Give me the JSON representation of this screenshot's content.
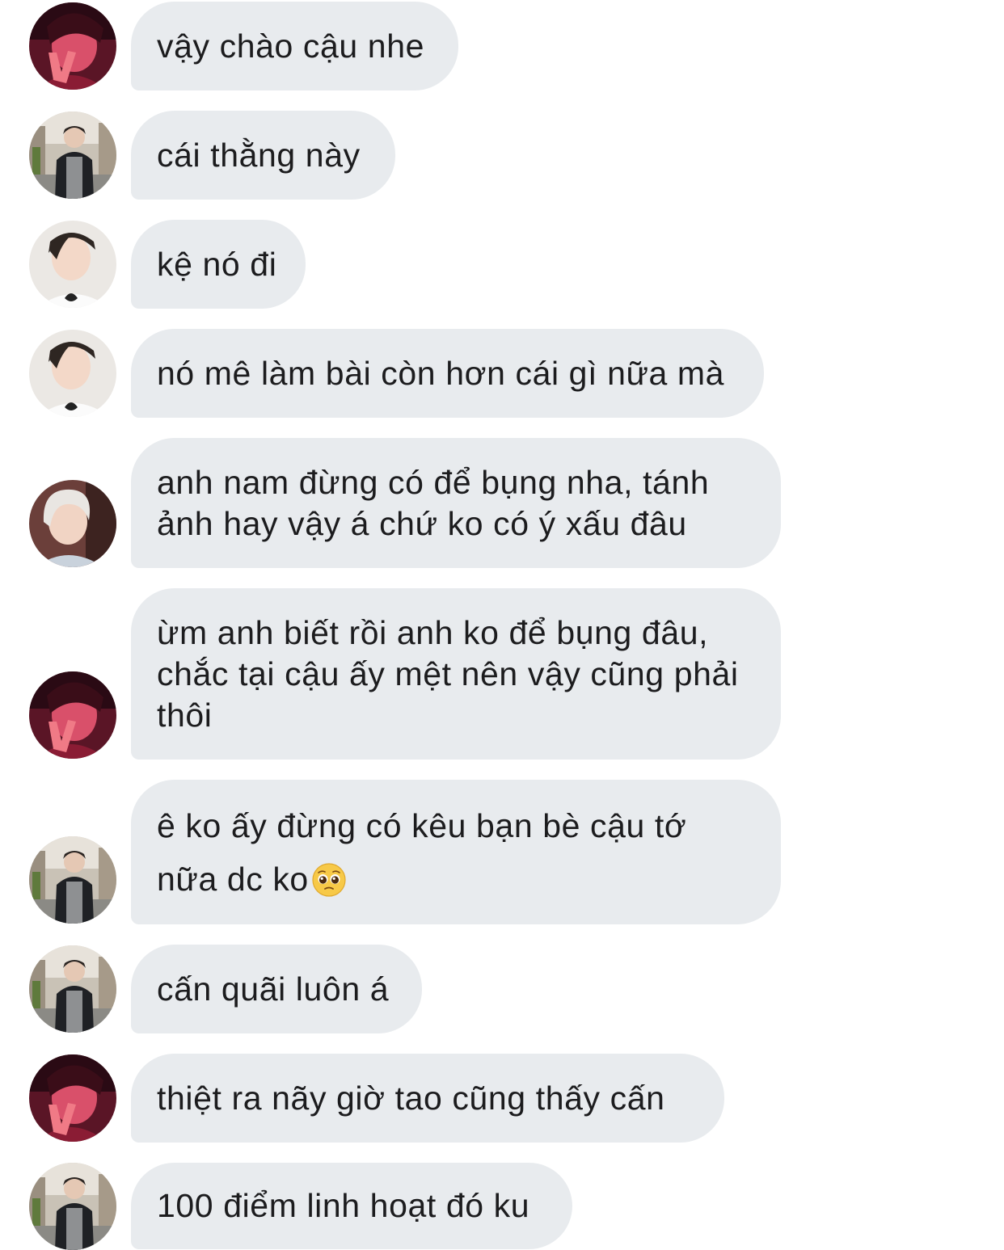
{
  "thread": {
    "messages": [
      {
        "id": "m1",
        "sender": "red-selfie",
        "text": "vậy chào cậu nhe"
      },
      {
        "id": "m2",
        "sender": "street-photo",
        "text": "cái thằng này"
      },
      {
        "id": "m3",
        "sender": "white-shirt",
        "text": "kệ nó đi"
      },
      {
        "id": "m4",
        "sender": "white-shirt",
        "text": "nó mê làm bài còn hơn cái gì nữa mà"
      },
      {
        "id": "m5",
        "sender": "blond-hair",
        "text": "anh nam đừng có để bụng nha, tánh ảnh hay vậy á chứ ko có ý xấu đâu"
      },
      {
        "id": "m6",
        "sender": "red-selfie",
        "text": "ừm anh biết rồi anh ko để bụng đâu, chắc tại cậu ấy mệt nên vậy cũng phải thôi"
      },
      {
        "id": "m7",
        "sender": "street-photo",
        "text": "ê ko ấy đừng có kêu bạn bè cậu tớ nữa dc ko",
        "emoji": "pleading-face-emoji"
      },
      {
        "id": "m8",
        "sender": "street-photo",
        "text": "cấn quãi luôn á"
      },
      {
        "id": "m9",
        "sender": "red-selfie",
        "text": "thiệt ra nãy giờ tao cũng thấy cấn"
      },
      {
        "id": "m10",
        "sender": "street-photo",
        "text": "100 điểm linh hoạt đó ku"
      }
    ]
  },
  "colors": {
    "bubble": "#e8ebee",
    "text": "#1c1c1e",
    "background": "#ffffff"
  }
}
